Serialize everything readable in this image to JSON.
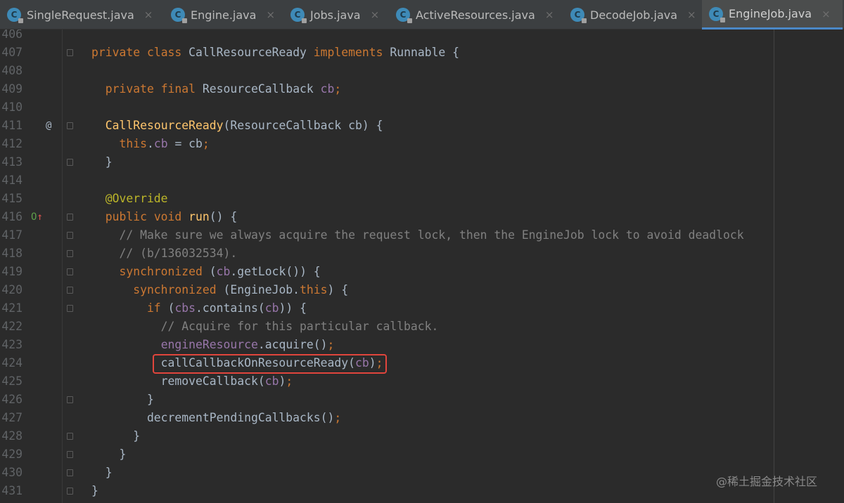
{
  "tabs": [
    {
      "label": "SingleRequest.java",
      "icon": "class-icon",
      "active": false
    },
    {
      "label": "Engine.java",
      "icon": "class-icon",
      "active": false
    },
    {
      "label": "Jobs.java",
      "icon": "class-icon",
      "active": false
    },
    {
      "label": "ActiveResources.java",
      "icon": "class-icon",
      "active": false
    },
    {
      "label": "DecodeJob.java",
      "icon": "class-icon",
      "active": false
    },
    {
      "label": "EngineJob.java",
      "icon": "class-icon",
      "active": true
    }
  ],
  "tab_icon_letter": "C",
  "close_glyph": "×",
  "colors": {
    "keyword": "#cc7832",
    "function": "#ffc66d",
    "field": "#9876aa",
    "comment": "#808080",
    "annotation": "#bbb529",
    "text": "#a9b7c6",
    "accent": "#4a88c7",
    "highlight_box": "#e0453c"
  },
  "editor": {
    "lines": [
      {
        "n": "406",
        "tokens": []
      },
      {
        "n": "407",
        "fold": true,
        "tokens": [
          [
            "private ",
            "kw"
          ],
          [
            "class ",
            "kw"
          ],
          [
            "CallResourceReady ",
            "pl"
          ],
          [
            "implements ",
            "kw"
          ],
          [
            "Runnable {",
            "pl"
          ]
        ]
      },
      {
        "n": "408",
        "tokens": []
      },
      {
        "n": "409",
        "tokens": [
          [
            "  private ",
            "kw"
          ],
          [
            "final ",
            "kw"
          ],
          [
            "ResourceCallback ",
            "pl"
          ],
          [
            "cb",
            "fld"
          ],
          [
            ";",
            "kw"
          ]
        ]
      },
      {
        "n": "410",
        "tokens": []
      },
      {
        "n": "411",
        "fold": true,
        "gutter": "@",
        "tokens": [
          [
            "  ",
            " pl"
          ],
          [
            "CallResourceReady",
            "fn"
          ],
          [
            "(ResourceCallback cb) {",
            "pl"
          ]
        ]
      },
      {
        "n": "412",
        "tokens": [
          [
            "    this",
            "kw"
          ],
          [
            ".",
            "pl"
          ],
          [
            "cb",
            "fld"
          ],
          [
            " = cb",
            "pl"
          ],
          [
            ";",
            "kw"
          ]
        ]
      },
      {
        "n": "413",
        "fold": true,
        "tokens": [
          [
            "  }",
            "pl"
          ]
        ]
      },
      {
        "n": "414",
        "tokens": []
      },
      {
        "n": "415",
        "tokens": [
          [
            "  @Override",
            "an"
          ]
        ]
      },
      {
        "n": "416",
        "fold": true,
        "gutter": "O↑",
        "tokens": [
          [
            "  public ",
            "kw"
          ],
          [
            "void ",
            "kw"
          ],
          [
            "run",
            "fn"
          ],
          [
            "() {",
            "pl"
          ]
        ]
      },
      {
        "n": "417",
        "fold": true,
        "tokens": [
          [
            "    // Make sure we always acquire the request lock, then the EngineJob lock to avoid deadlock",
            "cm"
          ]
        ]
      },
      {
        "n": "418",
        "fold": true,
        "tokens": [
          [
            "    // (b/136032534).",
            "cm"
          ]
        ]
      },
      {
        "n": "419",
        "fold": true,
        "tokens": [
          [
            "    synchronized ",
            "kw"
          ],
          [
            "(",
            "pl"
          ],
          [
            "cb",
            "fld"
          ],
          [
            ".getLock()) {",
            "pl"
          ]
        ]
      },
      {
        "n": "420",
        "fold": true,
        "tokens": [
          [
            "      synchronized ",
            "kw"
          ],
          [
            "(EngineJob.",
            "pl"
          ],
          [
            "this",
            "kw"
          ],
          [
            ") {",
            "pl"
          ]
        ]
      },
      {
        "n": "421",
        "fold": true,
        "tokens": [
          [
            "        if ",
            "kw"
          ],
          [
            "(",
            "pl"
          ],
          [
            "cbs",
            "fld"
          ],
          [
            ".contains(",
            "pl"
          ],
          [
            "cb",
            "fld"
          ],
          [
            ")) {",
            "pl"
          ]
        ]
      },
      {
        "n": "422",
        "tokens": [
          [
            "          // Acquire for this particular callback.",
            "cm"
          ]
        ]
      },
      {
        "n": "423",
        "tokens": [
          [
            "          ",
            "pl"
          ],
          [
            "engineResource",
            "fld"
          ],
          [
            ".acquire()",
            "pl"
          ],
          [
            ";",
            "kw"
          ]
        ]
      },
      {
        "n": "424",
        "tokens": [
          [
            "          callCallbackOnResourceReady(",
            "pl"
          ],
          [
            "cb",
            "fld"
          ],
          [
            ")",
            "pl"
          ],
          [
            ";",
            "kw"
          ]
        ]
      },
      {
        "n": "425",
        "tokens": [
          [
            "          removeCallback(",
            "pl"
          ],
          [
            "cb",
            "fld"
          ],
          [
            ")",
            "pl"
          ],
          [
            ";",
            "kw"
          ]
        ]
      },
      {
        "n": "426",
        "fold": true,
        "tokens": [
          [
            "        }",
            "pl"
          ]
        ]
      },
      {
        "n": "427",
        "tokens": [
          [
            "        decrementPendingCallbacks()",
            "pl"
          ],
          [
            ";",
            "kw"
          ]
        ]
      },
      {
        "n": "428",
        "fold": true,
        "tokens": [
          [
            "      }",
            "pl"
          ]
        ]
      },
      {
        "n": "429",
        "fold": true,
        "tokens": [
          [
            "    }",
            "pl"
          ]
        ]
      },
      {
        "n": "430",
        "fold": true,
        "tokens": [
          [
            "  }",
            "pl"
          ]
        ]
      },
      {
        "n": "431",
        "fold": true,
        "tokens": [
          [
            "}",
            "pl"
          ]
        ]
      }
    ]
  },
  "watermark": "@稀土掘金技术社区"
}
